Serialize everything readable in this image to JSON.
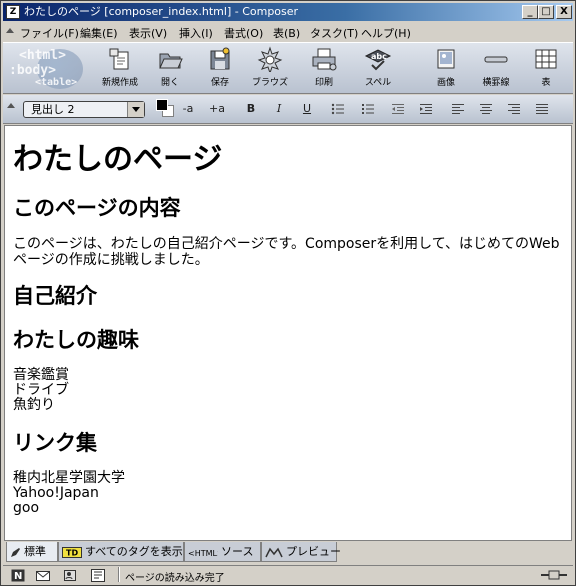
{
  "window": {
    "title": "わたしのページ [composer_index.html] - Composer",
    "app_icon": "composer-icon",
    "controls": {
      "minimize": "_",
      "maximize": "□",
      "close": "X"
    }
  },
  "menubar": {
    "items": [
      "ファイル(F)",
      "編集(E)",
      "表示(V)",
      "挿入(I)",
      "書式(O)",
      "表(B)",
      "タスク(T)",
      "ヘルプ(H)"
    ]
  },
  "toolbar": {
    "logo_text": [
      "<html>",
      ":body>",
      "<table>"
    ],
    "buttons": [
      {
        "label": "新規作成",
        "icon": "new-document-icon"
      },
      {
        "label": "開く",
        "icon": "open-folder-icon"
      },
      {
        "label": "保存",
        "icon": "save-icon"
      },
      {
        "label": "ブラウズ",
        "icon": "browse-icon"
      },
      {
        "label": "印刷",
        "icon": "print-icon"
      },
      {
        "label": "スペル",
        "icon": "spellcheck-icon"
      },
      {
        "label": "画像",
        "icon": "image-icon"
      },
      {
        "label": "横罫線",
        "icon": "horizontal-rule-icon"
      },
      {
        "label": "表",
        "icon": "table-icon"
      }
    ]
  },
  "format_toolbar": {
    "paragraph_style": "見出し 2",
    "smaller": "-a",
    "larger": "+a",
    "bold": "B",
    "italic": "I",
    "underline": "U"
  },
  "document": {
    "heading1": "わたしのページ",
    "section1_title": "このページの内容",
    "intro_text": "このページは、わたしの自己紹介ページです。Composerを利用して、はじめてのWebページの作成に挑戦しました。",
    "section2_title": "自己紹介",
    "section3_title": "わたしの趣味",
    "hobbies": [
      "音楽鑑賞",
      "ドライブ",
      "魚釣り"
    ],
    "section4_title": "リンク集",
    "links": [
      "稚内北星学園大学",
      "Yahoo!Japan",
      "goo"
    ]
  },
  "edit_tabs": [
    {
      "label": "標準",
      "icon": "pencil-icon"
    },
    {
      "label": "すべてのタグを表示",
      "icon": "tag-icon"
    },
    {
      "label": "ソース",
      "icon": "html-source-icon"
    },
    {
      "label": "プレビュー",
      "icon": "preview-icon"
    }
  ],
  "statusbar": {
    "text": "ページの読み込み完了"
  },
  "colors": {
    "title_start": "#0a246a",
    "title_end": "#a6caf0",
    "chrome": "#d4d0c8"
  }
}
